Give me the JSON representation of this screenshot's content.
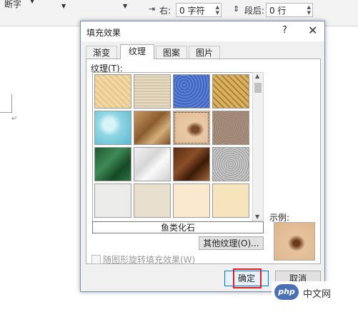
{
  "ribbon": {
    "font_fragment": "断字",
    "right_label": "右:",
    "right_value": "0 字符",
    "after_label": "段后:",
    "after_value": "0 行"
  },
  "dialog": {
    "title": "填充效果",
    "help": "?",
    "close": "✕",
    "tabs": [
      "渐变",
      "纹理",
      "图案",
      "图片"
    ],
    "active_tab": "纹理",
    "texture_label": "纹理(T):",
    "texture_names": [
      "纸莎草纸",
      "画布",
      "蓝色面巾纸",
      "编织物",
      "水滴",
      "纸袋",
      "鱼类化石",
      "沙滩",
      "绿色大理石",
      "白色大理石",
      "褐色大理石",
      "花岗岩",
      "新闻纸",
      "再生纸",
      "羊皮纸",
      "信纸"
    ],
    "selected_texture": "鱼类化石",
    "other_textures_button": "其他纹理(O)...",
    "example_label": "示例:",
    "rotate_checkbox": "随图形旋转填充效果(W)",
    "rotate_checked": false,
    "ok": "确定",
    "cancel": "取消"
  },
  "watermark": {
    "logo": "php",
    "text": "中文网"
  },
  "colors": {
    "ok_border": "#0078d7",
    "highlight": "#e02020"
  }
}
